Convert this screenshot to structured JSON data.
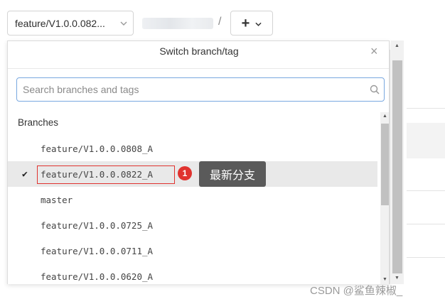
{
  "toolbar": {
    "branch_selector_label": "feature/V1.0.0.082...",
    "path_separator": "/",
    "add_label": "+"
  },
  "dropdown": {
    "title": "Switch branch/tag",
    "close_label": "×",
    "search_placeholder": "Search branches and tags",
    "section_label": "Branches",
    "items": [
      {
        "label": "feature/V1.0.0.0808_A",
        "selected": false
      },
      {
        "label": "feature/V1.0.0.0822_A",
        "selected": true
      },
      {
        "label": "master",
        "selected": false
      },
      {
        "label": "feature/V1.0.0.0725_A",
        "selected": false
      },
      {
        "label": "feature/V1.0.0.0711_A",
        "selected": false
      },
      {
        "label": "feature/V1.0.0.0620_A",
        "selected": false
      }
    ]
  },
  "annotation": {
    "badge_number": "1",
    "tooltip_text": "最新分支",
    "highlight_color": "#e0332f"
  },
  "icons": {
    "chevron": "chevron-down-icon",
    "search": "search-icon",
    "check": "check-icon",
    "close": "close-icon"
  },
  "watermark": "CSDN @鲨鱼辣椒_"
}
